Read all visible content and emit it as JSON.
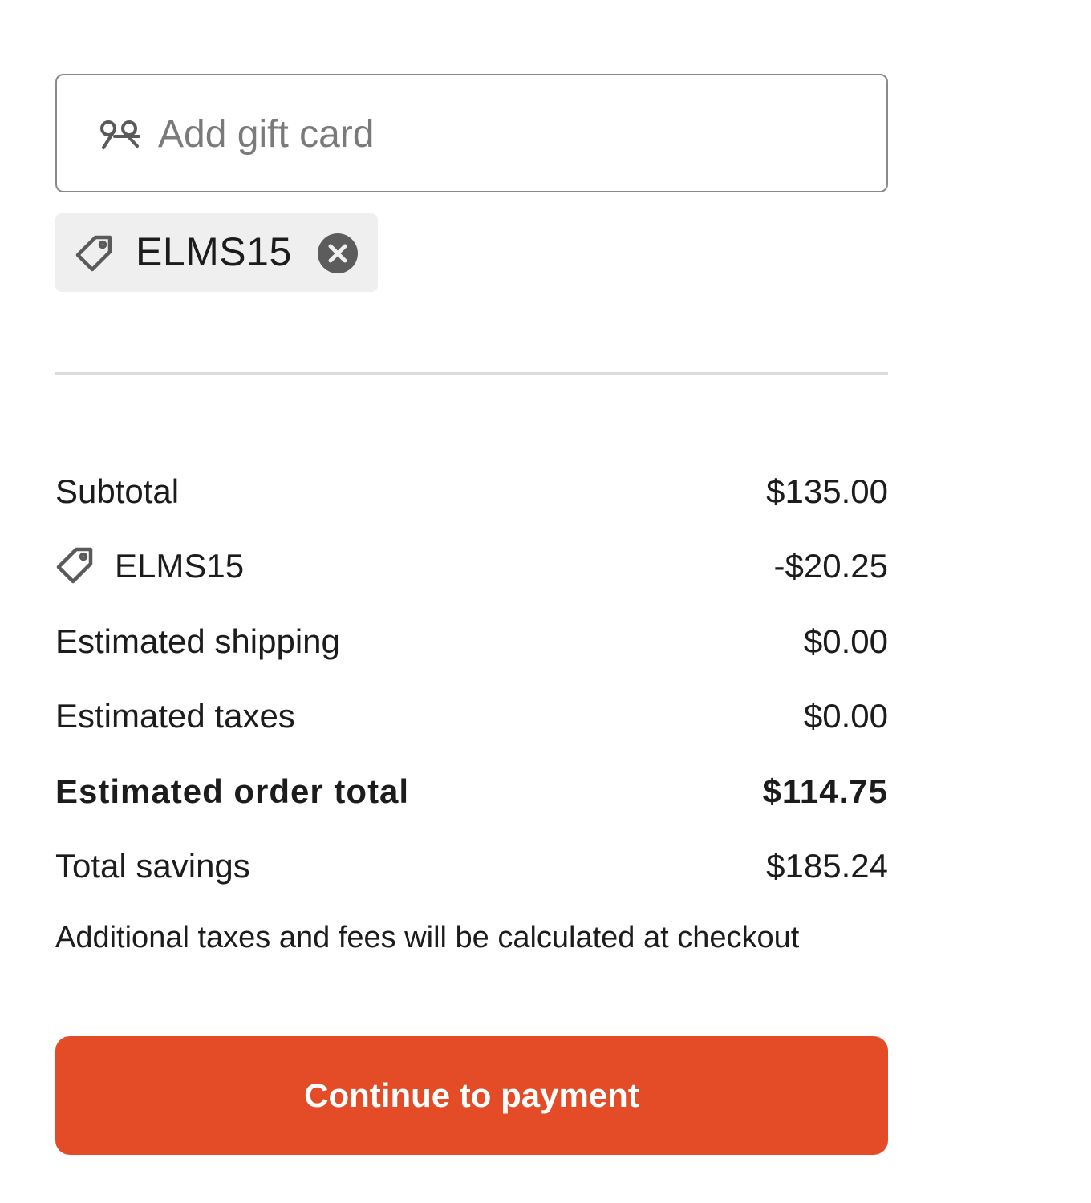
{
  "gift_card": {
    "placeholder": "Add gift card",
    "icon": "gift-icon"
  },
  "promo_chip": {
    "code": "ELMS15",
    "icon": "tag-icon",
    "remove_icon": "close-circle-icon"
  },
  "summary": {
    "subtotal_label": "Subtotal",
    "subtotal_value": "$135.00",
    "discount_label": "ELMS15",
    "discount_value": "-$20.25",
    "shipping_label": "Estimated shipping",
    "shipping_value": "$0.00",
    "taxes_label": "Estimated taxes",
    "taxes_value": "$0.00",
    "total_label": "Estimated order total",
    "total_value": "$114.75",
    "savings_label": "Total savings",
    "savings_value": "$185.24"
  },
  "note": "Additional taxes and fees will be calculated at checkout",
  "cta": {
    "label": "Continue to payment",
    "color": "#e34c26"
  }
}
